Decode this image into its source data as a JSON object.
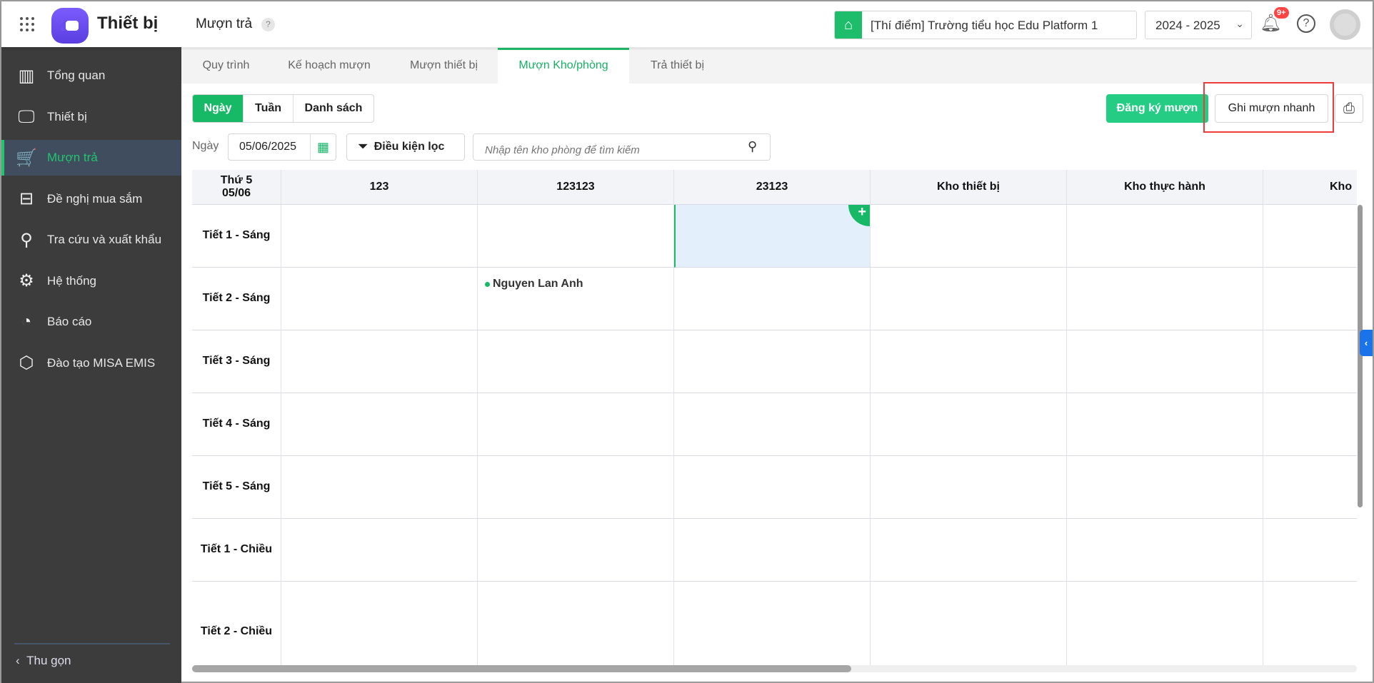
{
  "header": {
    "app_title": "Thiết bị",
    "page_title": "Mượn trả",
    "help_mark": "?",
    "school": "[Thí điểm] Trường tiểu học Edu Platform 1",
    "year": "2024 - 2025",
    "notification_count": "9+",
    "help_icon": "?"
  },
  "sidebar": {
    "items": [
      {
        "label": "Tổng quan",
        "icon": "▥"
      },
      {
        "label": "Thiết bị",
        "icon": "🖵"
      },
      {
        "label": "Mượn trả",
        "icon": "🛒"
      },
      {
        "label": "Đề nghị mua sắm",
        "icon": "⊟"
      },
      {
        "label": "Tra cứu và xuất khẩu",
        "icon": "⚲"
      },
      {
        "label": "Hệ thống",
        "icon": "⚙"
      },
      {
        "label": "Báo cáo",
        "icon": "◔"
      },
      {
        "label": "Đào tạo MISA EMIS",
        "icon": "⬡"
      }
    ],
    "active_index": 2,
    "collapse_label": "Thu gọn"
  },
  "tabs": [
    {
      "label": "Quy trình"
    },
    {
      "label": "Kế hoạch mượn"
    },
    {
      "label": "Mượn thiết bị"
    },
    {
      "label": "Mượn Kho/phòng",
      "active": true
    },
    {
      "label": "Trả thiết bị"
    }
  ],
  "toolbar": {
    "views": [
      "Ngày",
      "Tuần",
      "Danh sách"
    ],
    "active_view": "Ngày",
    "register_label": "Đăng ký mượn",
    "quick_label": "Ghi mượn nhanh"
  },
  "filters": {
    "date_label": "Ngày",
    "date_value": "05/06/2025",
    "filter_label": "Điều kiện lọc",
    "search_placeholder": "Nhập tên kho phòng để tìm kiếm"
  },
  "schedule": {
    "corner": [
      "Thứ 5",
      "05/06"
    ],
    "columns": [
      "123",
      "123123",
      "23123",
      "Kho thiết bị",
      "Kho thực hành",
      "Kho"
    ],
    "rows": [
      "Tiết 1 - Sáng",
      "Tiết 2 - Sáng",
      "Tiết 3 - Sáng",
      "Tiết 4 - Sáng",
      "Tiết 5 - Sáng",
      "Tiết 1 - Chiều",
      "Tiết 2 - Chiều"
    ],
    "selected": {
      "row": 0,
      "col": 2
    },
    "events": [
      {
        "row": 1,
        "col": 1,
        "name": "Nguyen Lan Anh"
      }
    ]
  },
  "colors": {
    "accent": "#17b967",
    "selected_bg": "#e3f0fc",
    "sidebar_bg": "#3c3c3c"
  }
}
